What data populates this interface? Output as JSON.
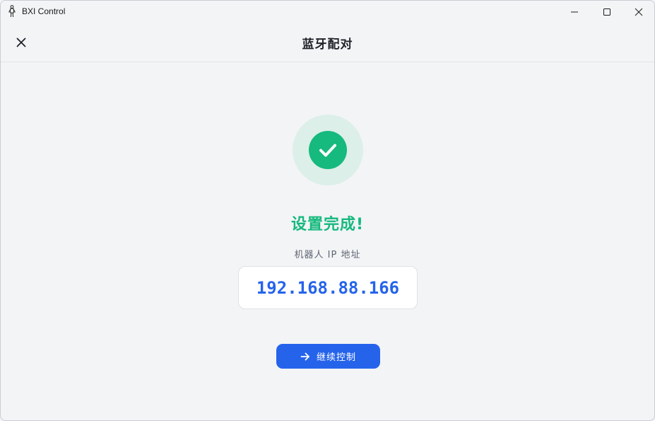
{
  "window": {
    "title": "BXI Control",
    "icons": {
      "app": "robot-figure-icon",
      "minimize": "minimize-icon",
      "maximize": "maximize-icon",
      "close": "close-icon"
    }
  },
  "header": {
    "title": "蓝牙配对",
    "close_icon": "close-icon"
  },
  "result": {
    "status_icon": "check-circle-icon",
    "title": "设置完成!",
    "ip_label": "机器人 IP 地址",
    "ip_address": "192.168.88.166"
  },
  "actions": {
    "continue_label": "继续控制",
    "continue_icon": "arrow-right-icon"
  },
  "colors": {
    "success": "#16b97e",
    "success_bg": "#dcefe8",
    "primary": "#2563eb",
    "background": "#f3f4f6"
  }
}
